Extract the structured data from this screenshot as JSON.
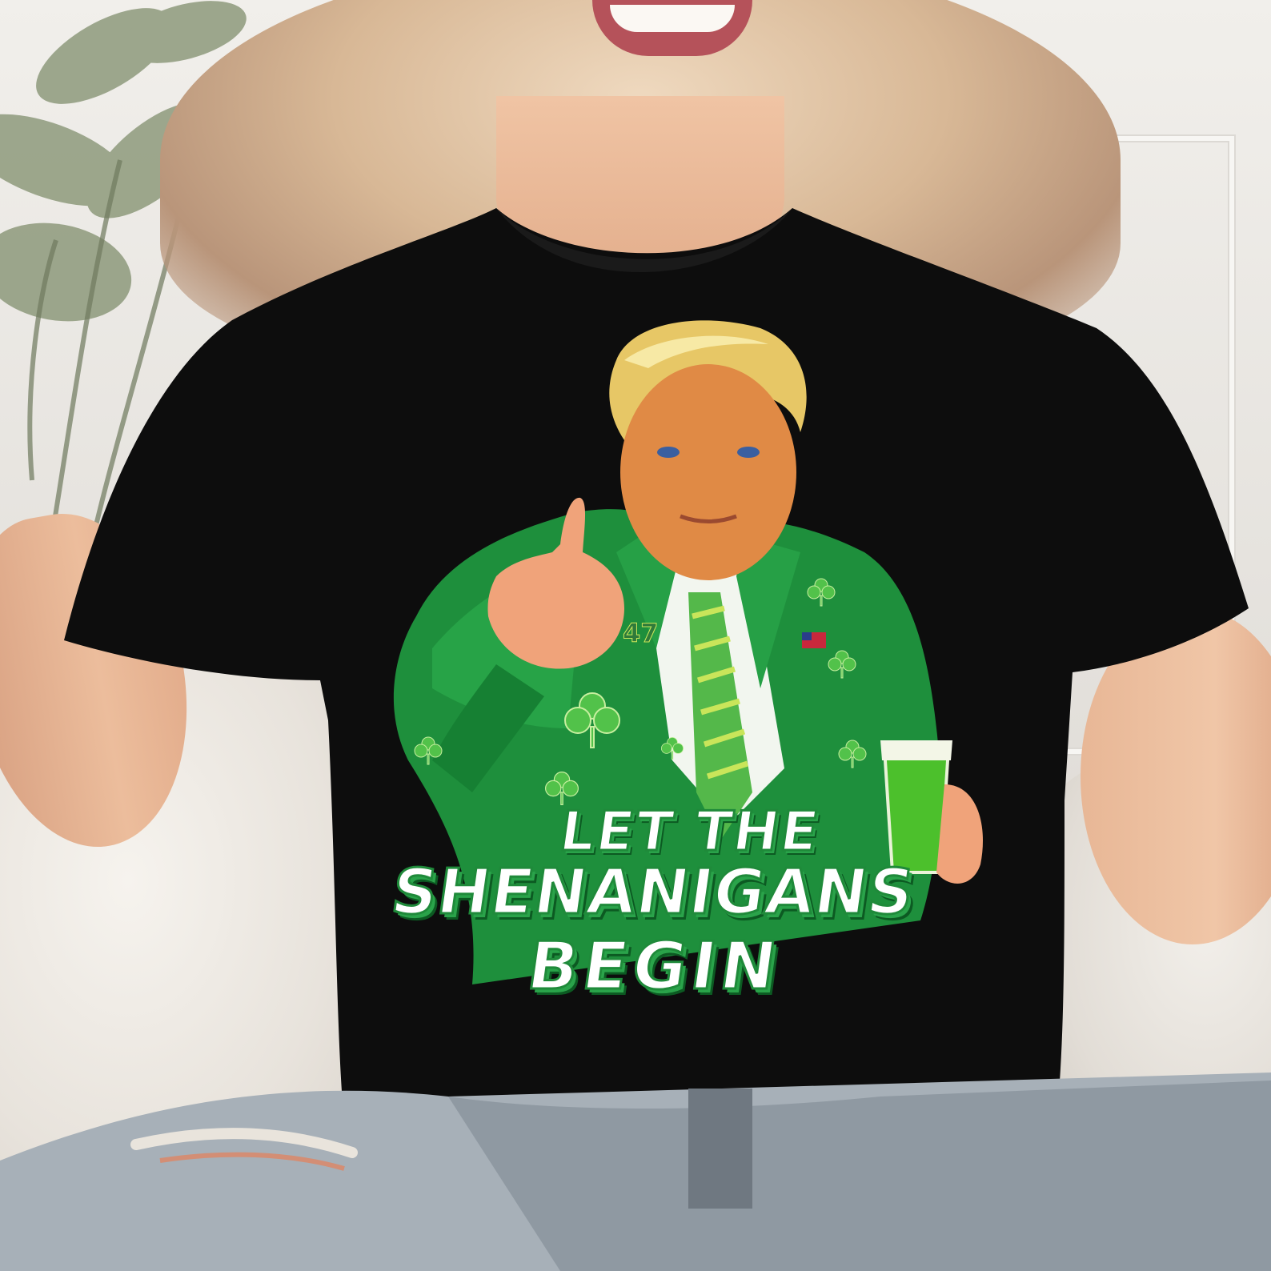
{
  "graphic": {
    "slogan_line1": "LET THE",
    "slogan_line2": "SHENANIGANS",
    "slogan_line3": "BEGIN",
    "lapel_pin": "47"
  },
  "colors": {
    "shirt": "#0d0d0d",
    "suit_green": "#1e8f3c",
    "suit_highlight": "#3ccf62",
    "slogan_fill": "#ffffff",
    "slogan_outline": "#1f8a3a",
    "hair_blonde": "#e7c766",
    "face_tan": "#e08a45",
    "beer_green": "#4cc02c"
  }
}
